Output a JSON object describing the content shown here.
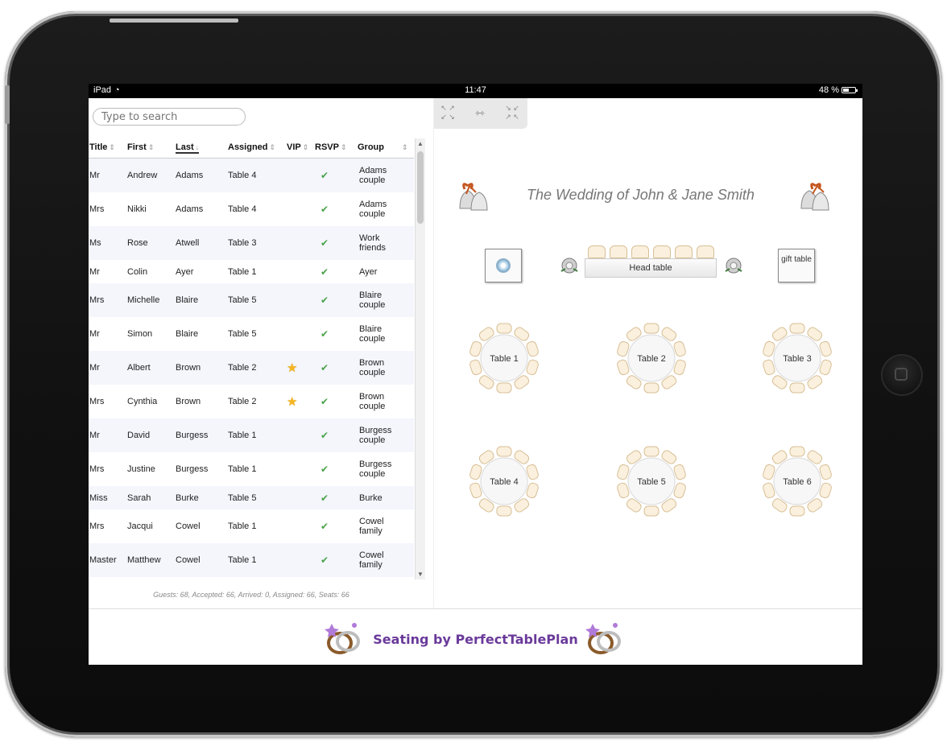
{
  "statusbar": {
    "device": "iPad",
    "time": "11:47",
    "battery": "48 %"
  },
  "search": {
    "placeholder": "Type to search"
  },
  "table": {
    "headers": {
      "title": "Title",
      "first": "First",
      "last": "Last",
      "assigned": "Assigned",
      "vip": "VIP",
      "rsvp": "RSVP",
      "group": "Group"
    },
    "rows": [
      {
        "title": "Mr",
        "first": "Andrew",
        "last": "Adams",
        "assigned": "Table 4",
        "vip": false,
        "rsvp": true,
        "group": "Adams couple"
      },
      {
        "title": "Mrs",
        "first": "Nikki",
        "last": "Adams",
        "assigned": "Table 4",
        "vip": false,
        "rsvp": true,
        "group": "Adams couple"
      },
      {
        "title": "Ms",
        "first": "Rose",
        "last": "Atwell",
        "assigned": "Table 3",
        "vip": false,
        "rsvp": true,
        "group": "Work friends"
      },
      {
        "title": "Mr",
        "first": "Colin",
        "last": "Ayer",
        "assigned": "Table 1",
        "vip": false,
        "rsvp": true,
        "group": "Ayer"
      },
      {
        "title": "Mrs",
        "first": "Michelle",
        "last": "Blaire",
        "assigned": "Table 5",
        "vip": false,
        "rsvp": true,
        "group": "Blaire couple"
      },
      {
        "title": "Mr",
        "first": "Simon",
        "last": "Blaire",
        "assigned": "Table 5",
        "vip": false,
        "rsvp": true,
        "group": "Blaire couple"
      },
      {
        "title": "Mr",
        "first": "Albert",
        "last": "Brown",
        "assigned": "Table 2",
        "vip": true,
        "rsvp": true,
        "group": "Brown couple"
      },
      {
        "title": "Mrs",
        "first": "Cynthia",
        "last": "Brown",
        "assigned": "Table 2",
        "vip": true,
        "rsvp": true,
        "group": "Brown couple"
      },
      {
        "title": "Mr",
        "first": "David",
        "last": "Burgess",
        "assigned": "Table 1",
        "vip": false,
        "rsvp": true,
        "group": "Burgess couple"
      },
      {
        "title": "Mrs",
        "first": "Justine",
        "last": "Burgess",
        "assigned": "Table 1",
        "vip": false,
        "rsvp": true,
        "group": "Burgess couple"
      },
      {
        "title": "Miss",
        "first": "Sarah",
        "last": "Burke",
        "assigned": "Table 5",
        "vip": false,
        "rsvp": true,
        "group": "Burke"
      },
      {
        "title": "Mrs",
        "first": "Jacqui",
        "last": "Cowel",
        "assigned": "Table 1",
        "vip": false,
        "rsvp": true,
        "group": "Cowel family"
      },
      {
        "title": "Master",
        "first": "Matthew",
        "last": "Cowel",
        "assigned": "Table 1",
        "vip": false,
        "rsvp": true,
        "group": "Cowel family"
      }
    ],
    "summary": "Guests: 68, Accepted: 66, Arrived: 0, Assigned: 66, Seats: 66"
  },
  "plan": {
    "title": "The Wedding of John & Jane Smith",
    "head_table": "Head table",
    "gift_table": "gift table",
    "tables": [
      "Table 1",
      "Table 2",
      "Table 3",
      "Table 4",
      "Table 5",
      "Table 6"
    ]
  },
  "footer": {
    "brand": "Seating by PerfectTablePlan"
  },
  "colors": {
    "check": "#4aa34a",
    "star": "#f5b520",
    "brand": "#6a3a9a",
    "seat": "#faf0dd"
  }
}
